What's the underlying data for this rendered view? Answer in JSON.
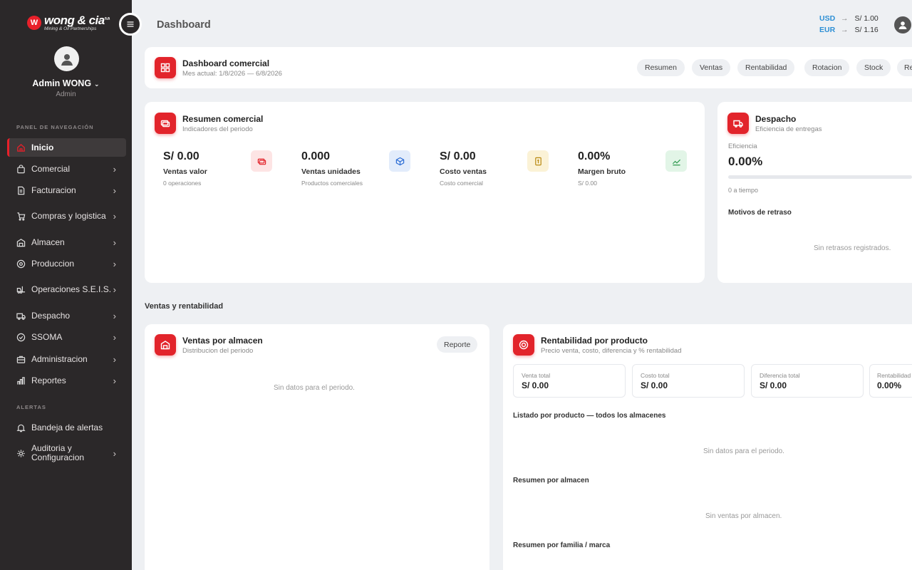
{
  "brand": {
    "mark": "W",
    "name": "wong & cia",
    "suffix": "s.a",
    "tagline": "Mining & Oil Partnerships"
  },
  "user": {
    "name": "Admin WONG",
    "role": "Admin"
  },
  "sidebar": {
    "nav_label": "PANEL DE NAVEGACIÓN",
    "items": [
      {
        "label": "Inicio",
        "icon": "home-icon"
      },
      {
        "label": "Comercial",
        "icon": "shopping-bag-icon"
      },
      {
        "label": "Facturacion",
        "icon": "invoice-icon"
      },
      {
        "label": "Compras y logistica",
        "icon": "cart-icon"
      },
      {
        "label": "Almacen",
        "icon": "warehouse-icon"
      },
      {
        "label": "Produccion",
        "icon": "gear-icon"
      },
      {
        "label": "Operaciones S.E.I.S.",
        "icon": "forklift-icon"
      },
      {
        "label": "Despacho",
        "icon": "truck-icon"
      },
      {
        "label": "SSOMA",
        "icon": "shield-icon"
      },
      {
        "label": "Administracion",
        "icon": "briefcase-icon"
      },
      {
        "label": "Reportes",
        "icon": "bar-chart-icon"
      }
    ],
    "alerts_label": "ALERTAS",
    "alert_items": [
      {
        "label": "Bandeja de alertas",
        "icon": "bell-icon"
      },
      {
        "label": "Auditoria y Configuracion",
        "icon": "settings-icon"
      }
    ]
  },
  "header": {
    "title": "Dashboard"
  },
  "fx": [
    {
      "currency": "USD",
      "value": "S/ 1.00"
    },
    {
      "currency": "EUR",
      "value": "S/ 1.16"
    }
  ],
  "dashboard": {
    "title": "Dashboard comercial",
    "subtitle": "Mes actual: 1/8/2026 — 6/8/2026",
    "tabs": [
      "Resumen",
      "Ventas",
      "Rentabilidad",
      "Rotacion",
      "Stock",
      "Re"
    ]
  },
  "resumen": {
    "title": "Resumen comercial",
    "subtitle": "Indicadores del periodo",
    "kpis": [
      {
        "value": "S/ 0.00",
        "label": "Ventas valor",
        "sub": "0 operaciones",
        "icon": "money-icon",
        "color": "#fde4e4"
      },
      {
        "value": "0.000",
        "label": "Ventas unidades",
        "sub": "Productos comerciales",
        "icon": "box-icon",
        "color": "#e2ecfb"
      },
      {
        "value": "S/ 0.00",
        "label": "Costo ventas",
        "sub": "Costo comercial",
        "icon": "receipt-icon",
        "color": "#fbf2d6"
      },
      {
        "value": "0.00%",
        "label": "Margen bruto",
        "sub": "S/ 0.00",
        "icon": "trend-icon",
        "color": "#e2f5e7"
      }
    ]
  },
  "despacho": {
    "title": "Despacho",
    "subtitle": "Eficiencia de entregas",
    "eff_label": "Eficiencia",
    "eff_value": "0.00%",
    "eff_fraction": 0,
    "on_time": "0 a tiempo",
    "delays_title": "Motivos de retraso",
    "empty": "Sin retrasos registrados."
  },
  "section_title": "Ventas y rentabilidad",
  "ventas_almacen": {
    "title": "Ventas por almacen",
    "subtitle": "Distribucion del periodo",
    "button": "Reporte",
    "empty": "Sin datos para el periodo."
  },
  "rentabilidad": {
    "title": "Rentabilidad por producto",
    "subtitle": "Precio venta, costo, diferencia y % rentabilidad",
    "stats": [
      {
        "label": "Venta total",
        "value": "S/ 0.00"
      },
      {
        "label": "Costo total",
        "value": "S/ 0.00"
      },
      {
        "label": "Diferencia total",
        "value": "S/ 0.00"
      },
      {
        "label": "Rentabilidad",
        "value": "0.00%"
      }
    ],
    "list_title": "Listado por producto — todos los almacenes",
    "list_empty": "Sin datos para el periodo.",
    "almacen_title": "Resumen por almacen",
    "almacen_empty": "Sin ventas por almacen.",
    "familia_title": "Resumen por familia / marca"
  }
}
